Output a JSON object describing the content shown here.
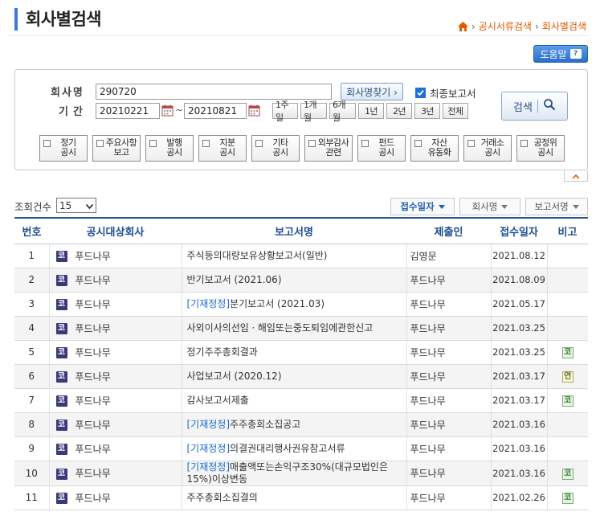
{
  "page": {
    "title": "회사별검색",
    "breadcrumb": [
      "공시서류검색",
      "회사별검색"
    ],
    "help_label": "도움말"
  },
  "search": {
    "company_label": "회사명",
    "company_value": "290720",
    "find_company_label": "회사명찾기 ›",
    "final_report_label": "최종보고서",
    "final_report_checked": true,
    "period_label": "기간",
    "date_from": "20210221",
    "date_sep": "~",
    "date_to": "20210821",
    "period_buttons": [
      "1주일",
      "1개월",
      "6개월",
      "1년",
      "2년",
      "3년",
      "전체"
    ],
    "search_label": "검색",
    "categories": [
      {
        "line1": "정기",
        "line2": "공시"
      },
      {
        "line1": "주요사항",
        "line2": "보고"
      },
      {
        "line1": "발행",
        "line2": "공시"
      },
      {
        "line1": "지분",
        "line2": "공시"
      },
      {
        "line1": "기타",
        "line2": "공시"
      },
      {
        "line1": "외부감사",
        "line2": "관련"
      },
      {
        "line1": "펀드",
        "line2": "공시"
      },
      {
        "line1": "자산",
        "line2": "유동화"
      },
      {
        "line1": "거래소",
        "line2": "공시"
      },
      {
        "line1": "공정위",
        "line2": "공시"
      }
    ]
  },
  "list": {
    "count_label": "조회건수",
    "count_value": "15",
    "sort_buttons": [
      {
        "label": "접수일자",
        "active": true
      },
      {
        "label": "회사명",
        "active": false
      },
      {
        "label": "보고서명",
        "active": false
      }
    ],
    "columns": [
      "번호",
      "공시대상회사",
      "보고서명",
      "제출인",
      "접수일자",
      "비고"
    ],
    "market_badge": "코",
    "rows": [
      {
        "no": "1",
        "company": "푸드나무",
        "amend": "",
        "report": "주식등의대량보유상황보고서(일반)",
        "submitter": "김영문",
        "date": "2021.08.12",
        "note": ""
      },
      {
        "no": "2",
        "company": "푸드나무",
        "amend": "",
        "report": "반기보고서 (2021.06)",
        "submitter": "푸드나무",
        "date": "2021.08.09",
        "note": ""
      },
      {
        "no": "3",
        "company": "푸드나무",
        "amend": "[기재정정]",
        "report": "분기보고서 (2021.03)",
        "submitter": "푸드나무",
        "date": "2021.05.17",
        "note": ""
      },
      {
        "no": "4",
        "company": "푸드나무",
        "amend": "",
        "report": "사외이사의선임ㆍ해임또는중도퇴임에관한신고",
        "submitter": "푸드나무",
        "date": "2021.03.25",
        "note": ""
      },
      {
        "no": "5",
        "company": "푸드나무",
        "amend": "",
        "report": "정기주주총회결과",
        "submitter": "푸드나무",
        "date": "2021.03.25",
        "note": "코"
      },
      {
        "no": "6",
        "company": "푸드나무",
        "amend": "",
        "report": "사업보고서 (2020.12)",
        "submitter": "푸드나무",
        "date": "2021.03.17",
        "note": "연"
      },
      {
        "no": "7",
        "company": "푸드나무",
        "amend": "",
        "report": "감사보고서제출",
        "submitter": "푸드나무",
        "date": "2021.03.17",
        "note": "코"
      },
      {
        "no": "8",
        "company": "푸드나무",
        "amend": "[기재정정]",
        "report": "주주총회소집공고",
        "submitter": "푸드나무",
        "date": "2021.03.16",
        "note": ""
      },
      {
        "no": "9",
        "company": "푸드나무",
        "amend": "[기재정정]",
        "report": "의결권대리행사권유참고서류",
        "submitter": "푸드나무",
        "date": "2021.03.16",
        "note": ""
      },
      {
        "no": "10",
        "company": "푸드나무",
        "amend": "[기재정정]",
        "report": "매출액또는손익구조30%(대규모법인은15%)이상변동",
        "submitter": "푸드나무",
        "date": "2021.03.16",
        "note": "코"
      },
      {
        "no": "11",
        "company": "푸드나무",
        "amend": "",
        "report": "주주총회소집결의",
        "submitter": "푸드나무",
        "date": "2021.02.26",
        "note": "코"
      }
    ]
  },
  "colors": {
    "accent": "#3a7bd5",
    "header_text": "#1e4f93",
    "amend_link": "#1a6bd1",
    "breadcrumb": "#e05a00"
  }
}
